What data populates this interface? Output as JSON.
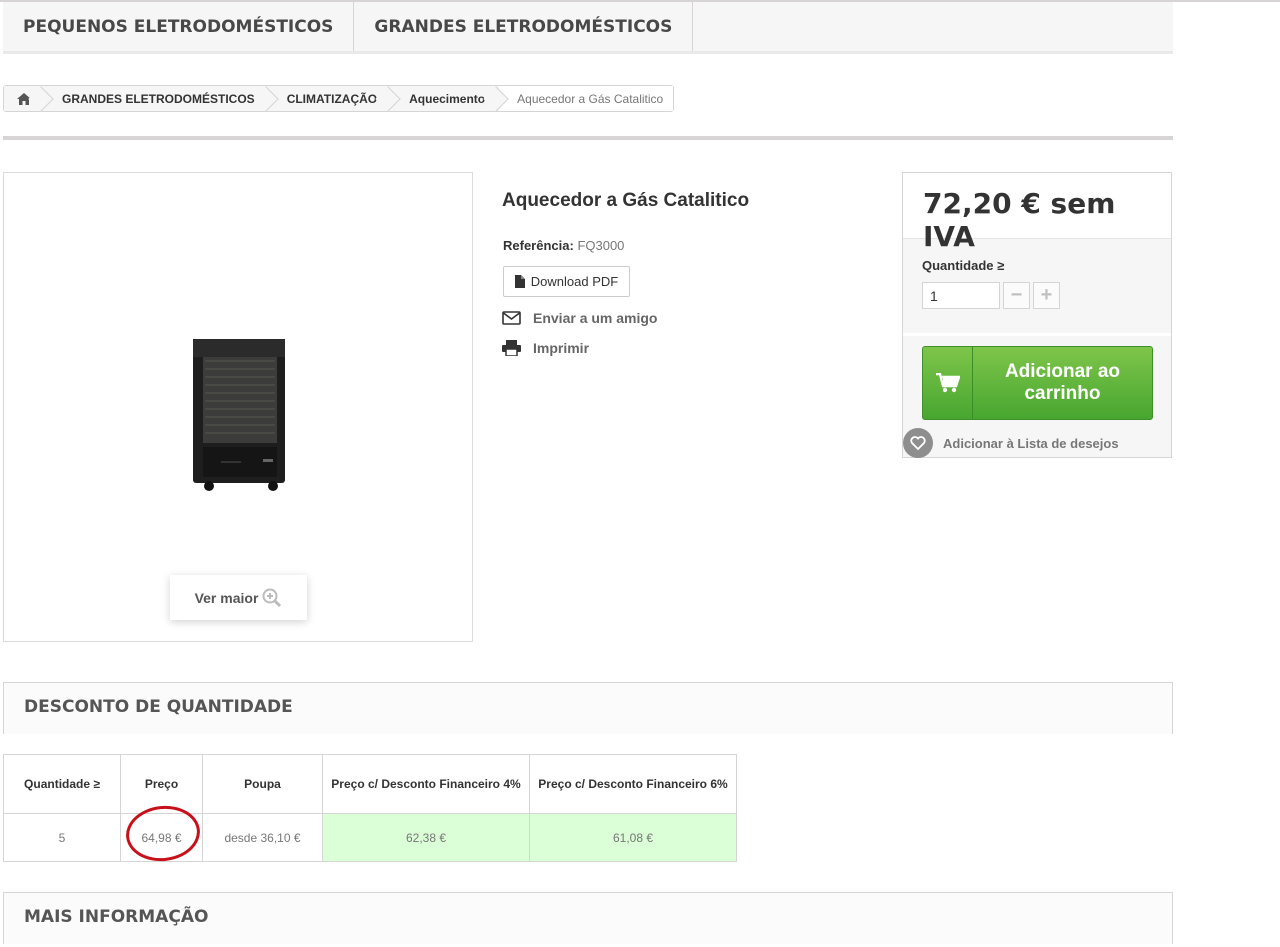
{
  "menu": {
    "items": [
      "PEQUENOS ELETRODOMÉSTICOS",
      "GRANDES ELETRODOMÉSTICOS"
    ]
  },
  "breadcrumb": {
    "home_icon": "home-icon",
    "items": [
      "GRANDES ELETRODOMÉSTICOS",
      "CLIMATIZAÇÃO",
      "Aquecimento"
    ],
    "current": "Aquecedor a Gás Catalitico"
  },
  "image": {
    "ver_maior_label": "Ver maior",
    "zoom_icon": "zoom-in-icon"
  },
  "product": {
    "title": "Aquecedor a Gás Catalitico",
    "reference_label": "Referência:",
    "reference_value": "FQ3000",
    "pdf_label": "Download PDF",
    "send_friend_label": "Enviar a um amigo",
    "print_label": "Imprimir"
  },
  "buy": {
    "price": "72,20 € sem IVA",
    "quantity_label": "Quantidade ≥",
    "quantity_value": "1",
    "minus_label": "−",
    "plus_label": "+",
    "cart_label": "Adicionar ao carrinho",
    "wishlist_label": "Adicionar à Lista de desejos",
    "accent_color": "#5cb13c"
  },
  "discount": {
    "title": "DESCONTO DE QUANTIDADE",
    "headers": [
      "Quantidade ≥",
      "Preço",
      "Poupa",
      "Preço c/ Desconto Financeiro 4%",
      "Preço c/ Desconto Financeiro 6%"
    ],
    "row": [
      "5",
      "64,98 €",
      "desde 36,10 €",
      "62,38 €",
      "61,08 €"
    ],
    "highlight_color": "#dbffd6"
  },
  "more_info": {
    "title": "MAIS INFORMAÇÃO"
  }
}
